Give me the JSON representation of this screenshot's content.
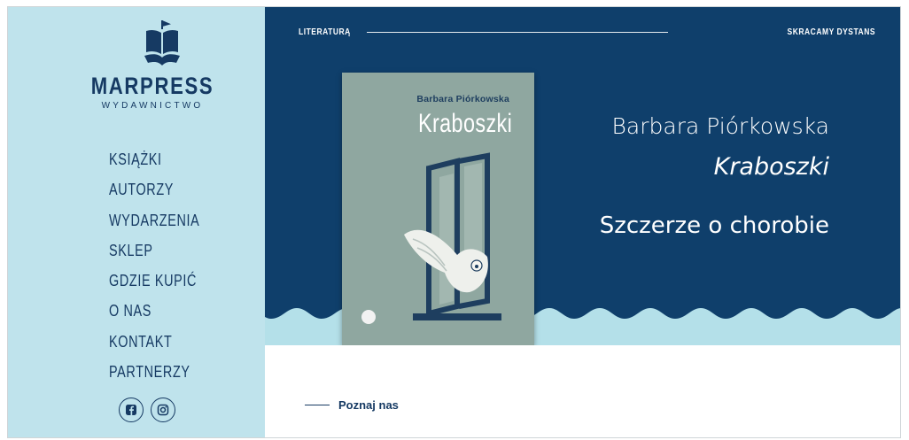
{
  "brand": {
    "name": "MARPRESS",
    "subtitle": "WYDAWNICTWO"
  },
  "nav": {
    "items": [
      {
        "label": "KSIĄŻKI",
        "key": "ksiazki"
      },
      {
        "label": "AUTORZY",
        "key": "autorzy"
      },
      {
        "label": "WYDARZENIA",
        "key": "wydarzenia"
      },
      {
        "label": "SKLEP",
        "key": "sklep"
      },
      {
        "label": "GDZIE KUPIĆ",
        "key": "gdzie-kupic"
      },
      {
        "label": "O NAS",
        "key": "o-nas"
      },
      {
        "label": "KONTAKT",
        "key": "kontakt"
      },
      {
        "label": "PARTNERZY",
        "key": "partnerzy"
      }
    ]
  },
  "social": {
    "icons": [
      "facebook-icon",
      "instagram-icon"
    ]
  },
  "hero": {
    "category": "LITERATURĄ",
    "slogan": "SKRACAMY DYSTANS",
    "author": "Barbara Piórkowska",
    "title": "Kraboszki",
    "tagline": "Szczerze o chorobie"
  },
  "book": {
    "author": "Barbara Piórkowska",
    "title": "Kraboszki"
  },
  "section": {
    "link_label": "Poznaj nas"
  },
  "colors": {
    "navy": "#163a63",
    "sidebar": "#bfe3ec",
    "hero_bg": "#0f3f6b",
    "wave_light": "#b4e0e9",
    "book_cover": "#8fa7a0"
  }
}
